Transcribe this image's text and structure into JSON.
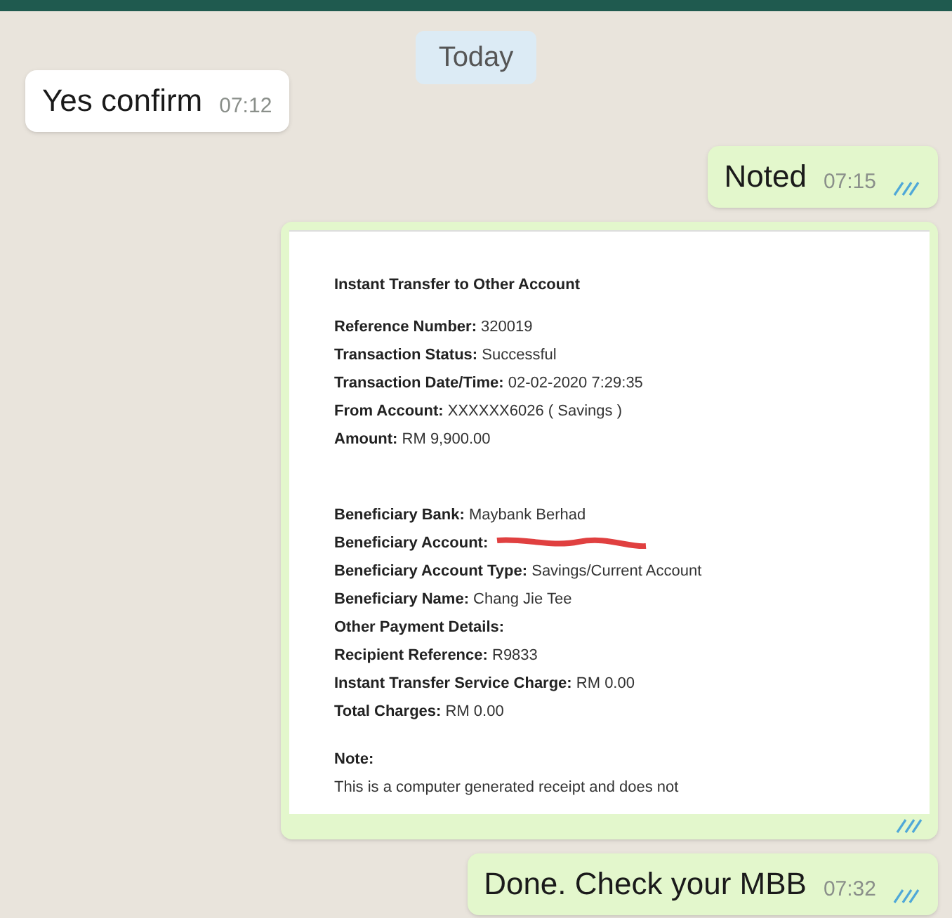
{
  "date_divider": "Today",
  "messages": [
    {
      "kind": "text",
      "outgoing": false,
      "text": "Yes confirm",
      "time": "07:12"
    },
    {
      "kind": "text",
      "outgoing": true,
      "text": "Noted",
      "time": "07:15",
      "read": true
    },
    {
      "kind": "receipt",
      "outgoing": true,
      "read": true,
      "receipt": {
        "title": "Instant Transfer to Other Account",
        "groups": [
          [
            {
              "text": "**Reference Number:** 320019"
            },
            {
              "text": "**Transaction Status:** Successful"
            },
            {
              "text": "**Transaction Date/Time:** 02-02-2020 7:29:35"
            },
            {
              "text": "**From Account:** XXXXXX6026 ( Savings )"
            },
            {
              "text": "**Amount:** RM 9,900.00"
            }
          ],
          [
            {
              "text": "**Beneficiary Bank:** Maybank Berhad"
            },
            {
              "text": "**Beneficiary Account:**",
              "redacted": true
            },
            {
              "text": "**Beneficiary Account Type:** Savings/Current Account"
            },
            {
              "text": "**Beneficiary Name:** Chang Jie Tee"
            },
            {
              "text": "**Other Payment Details:**"
            },
            {
              "text": "**Recipient Reference:** R9833"
            },
            {
              "text": "**Instant Transfer Service Charge:** RM 0.00"
            },
            {
              "text": "**Total Charges:** RM 0.00"
            }
          ]
        ],
        "note_title": "Note:",
        "note_text": "This is a computer generated receipt and does not"
      }
    },
    {
      "kind": "text",
      "outgoing": true,
      "text": "Done. Check your MBB",
      "time": "07:32",
      "read": true
    }
  ]
}
